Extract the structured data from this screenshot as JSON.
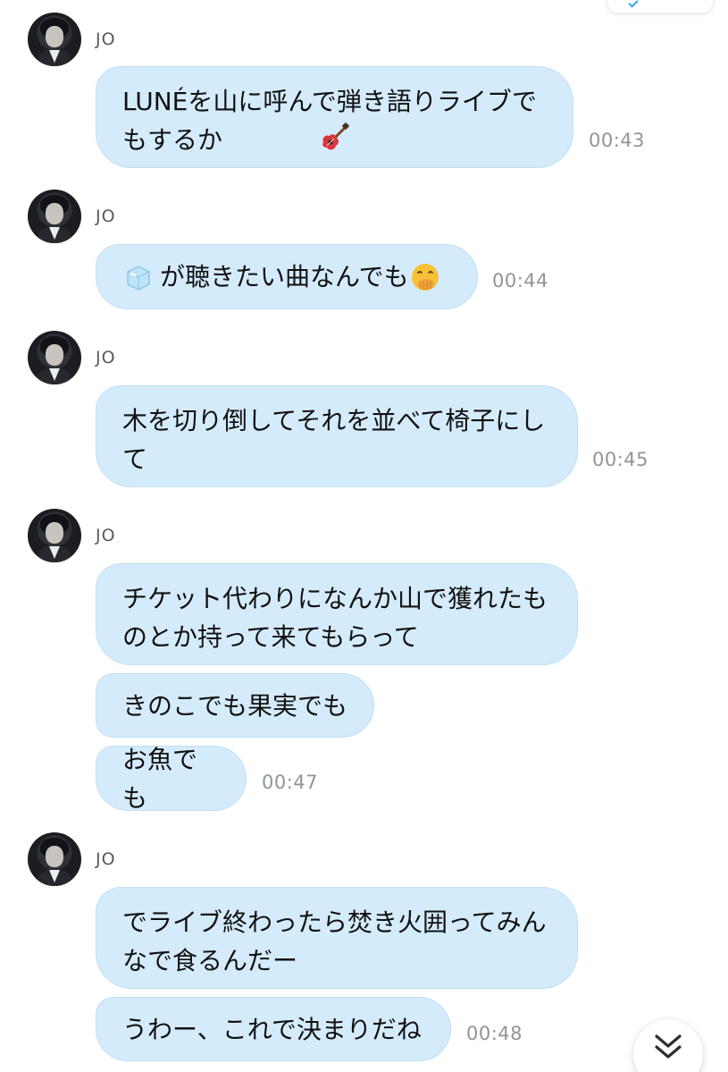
{
  "chat": {
    "sender_name": "JO",
    "messages": [
      {
        "text": "LUNÉを山に呼んで弾き語りライブで\nもするか",
        "emoji_after": "guitar",
        "time": "00:43"
      },
      {
        "emoji_before": "ice-cube",
        "text": "が聴きたい曲なんでも",
        "emoji_after": "face-hand-over-mouth",
        "time": "00:44"
      },
      {
        "text": "木を切り倒してそれを並べて椅子にし\nて",
        "time": "00:45"
      },
      {
        "text": "チケット代わりになんか山で獲れたも\nのとか持って来てもらって"
      },
      {
        "text": "きのこでも果実でも"
      },
      {
        "text": "お魚でも",
        "time": "00:47"
      },
      {
        "text": "でライブ終わったら焚き火囲ってみん\nなで食るんだー"
      },
      {
        "text": "うわー、これで決まりだね",
        "time": "00:48"
      }
    ]
  },
  "controls": {
    "scroll_down_icon": "double-chevron-down-icon",
    "top_chip_icon": "check-icon"
  },
  "colors": {
    "bubble": "#d4ebfb",
    "bubble_border": "#c1dff3",
    "timestamp": "#8e959c",
    "sender": "#555a60",
    "accent": "#39a4f0"
  }
}
